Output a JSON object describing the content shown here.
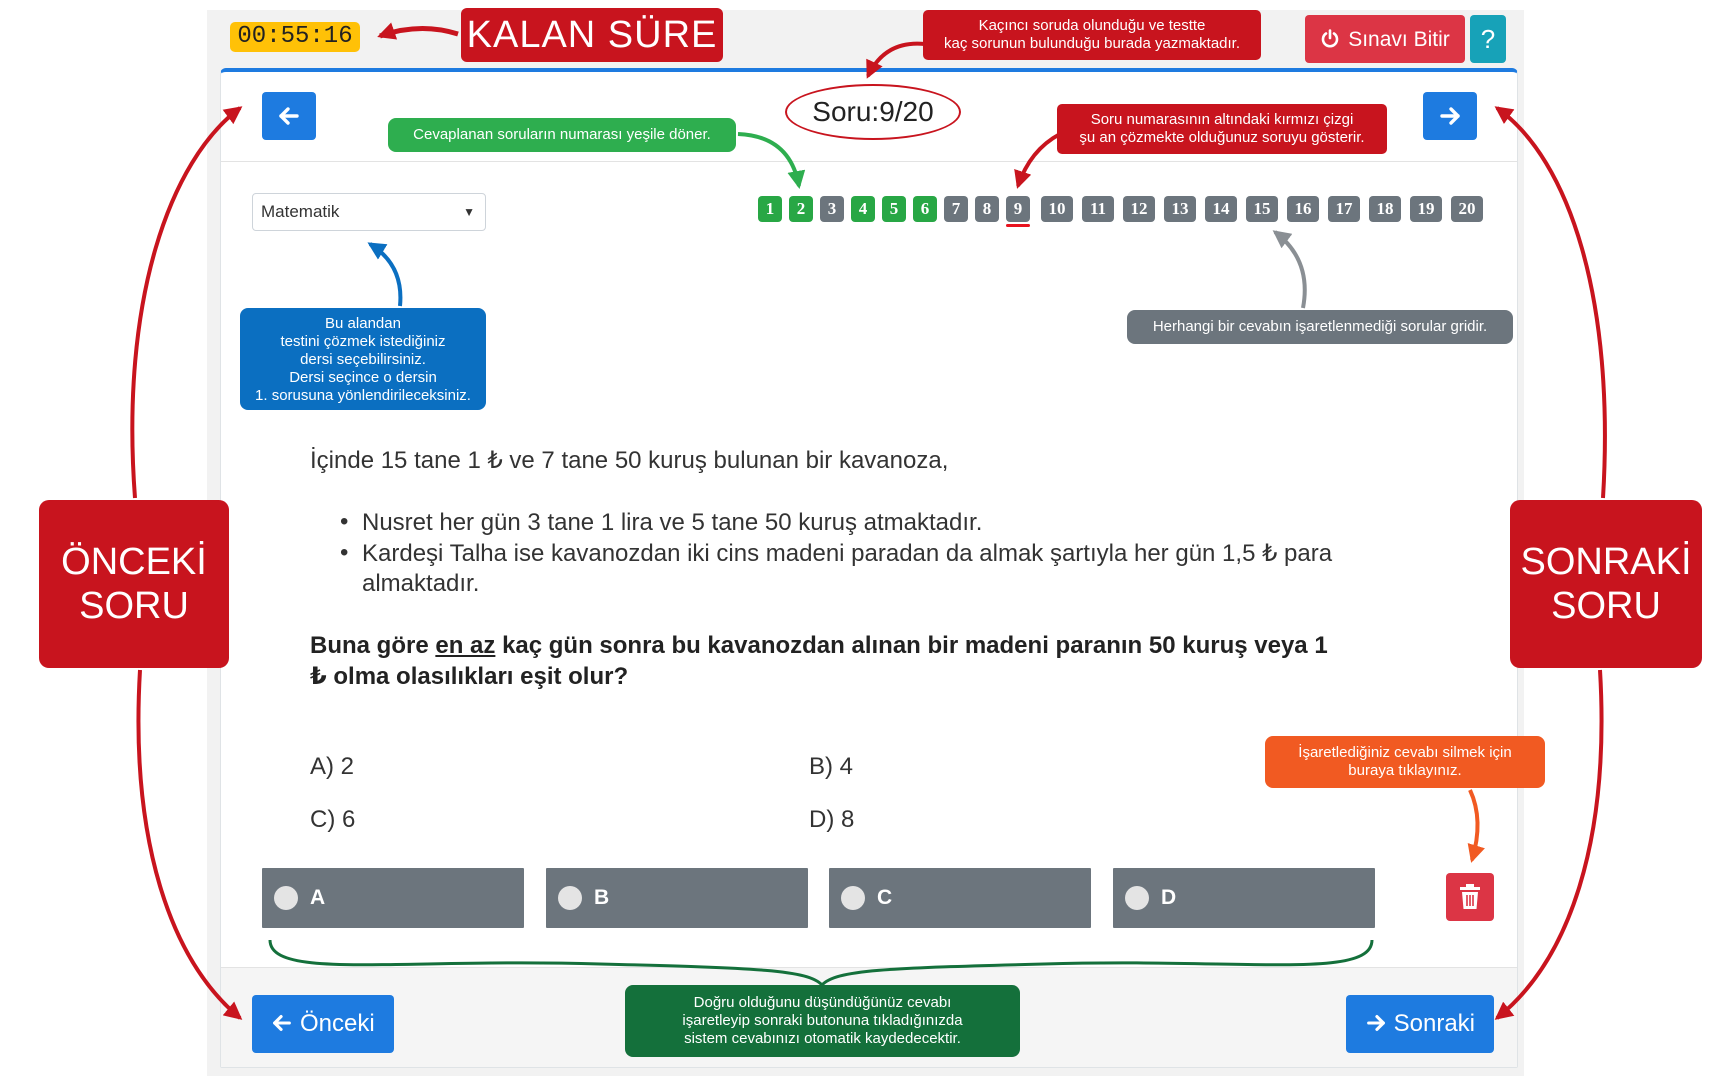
{
  "header": {
    "timer": "00:55:16",
    "finish_label": "Sınavı Bitir",
    "help_label": "?"
  },
  "annotations": {
    "kalan_sure": "KALAN SÜRE",
    "soru_info_line1": "Kaçıncı soruda olunduğu ve testte",
    "soru_info_line2": "kaç sorunun bulunduğu burada yazmaktadır.",
    "green_note": "Cevaplanan soruların numarası yeşile döner.",
    "red_line_line1": "Soru numarasının altındaki kırmızı çizgi",
    "red_line_line2": "şu an çözmekte olduğunuz soruyu gösterir.",
    "blue_line1": "Bu alandan",
    "blue_line2": "testini çözmek istediğiniz",
    "blue_line3": "dersi seçebilirsiniz.",
    "blue_line4": "Dersi seçince o dersin",
    "blue_line5": "1. sorusuna yönlendirileceksiniz.",
    "gray_note": "Herhangi bir cevabın işaretlenmediği sorular gridir.",
    "orange_line1": "İşaretlediğiniz cevabı silmek için",
    "orange_line2": "buraya tıklayınız.",
    "dkgreen_line1": "Doğru olduğunu düşündüğünüz cevabı",
    "dkgreen_line2": "işaretleyip sonraki butonuna tıkladığınızda",
    "dkgreen_line3": "sistem cevabınızı otomatik kaydedecektir.",
    "onceki_line1": "ÖNCEKİ",
    "onceki_line2": "SORU",
    "sonraki_line1": "SONRAKİ",
    "sonraki_line2": "SORU"
  },
  "counter": "Soru:9/20",
  "subject": {
    "selected": "Matematik"
  },
  "questions": {
    "numbers": [
      "1",
      "2",
      "3",
      "4",
      "5",
      "6",
      "7",
      "8",
      "9",
      "10",
      "11",
      "12",
      "13",
      "14",
      "15",
      "16",
      "17",
      "18",
      "19",
      "20"
    ],
    "answered": [
      1,
      2,
      4,
      5,
      6
    ],
    "current": 9
  },
  "question": {
    "intro": "İçinde 15 tane 1 ₺ ve 7 tane 50 kuruş bulunan bir kavanoza,",
    "bullet1": "Nusret her gün 3 tane 1 lira ve 5 tane 50 kuruş atmaktadır.",
    "bullet2_line1": "Kardeşi Talha ise kavanozdan iki cins madeni paradan da almak şartıyla her gün 1,5 ₺ para",
    "bullet2_line2": "almaktadır.",
    "main_pre": "Buna göre",
    "main_underline": "en az",
    "main_post1": "kaç gün sonra bu kavanozdan alınan bir madeni paranın 50 kuruş veya 1",
    "main_post2": "₺ olma olasılıkları eşit olur?",
    "option_a": "A) 2",
    "option_b": "B) 4",
    "option_c": "C) 6",
    "option_d": "D) 8"
  },
  "answers": [
    "A",
    "B",
    "C",
    "D"
  ],
  "footer": {
    "prev_label": "Önceki",
    "next_label": "Sonraki"
  },
  "colors": {
    "primary": "#1e7be0",
    "danger": "#dc3545",
    "answered": "#28a745",
    "unanswered": "#6c757d",
    "annotation_red": "#c8141e",
    "timer": "#ffc107",
    "help": "#17a2b8"
  },
  "icons": {
    "finish": "power-icon",
    "help": "question-icon",
    "prev": "arrow-left-icon",
    "next": "arrow-right-icon",
    "delete": "trash-icon",
    "select": "caret-down-icon"
  }
}
